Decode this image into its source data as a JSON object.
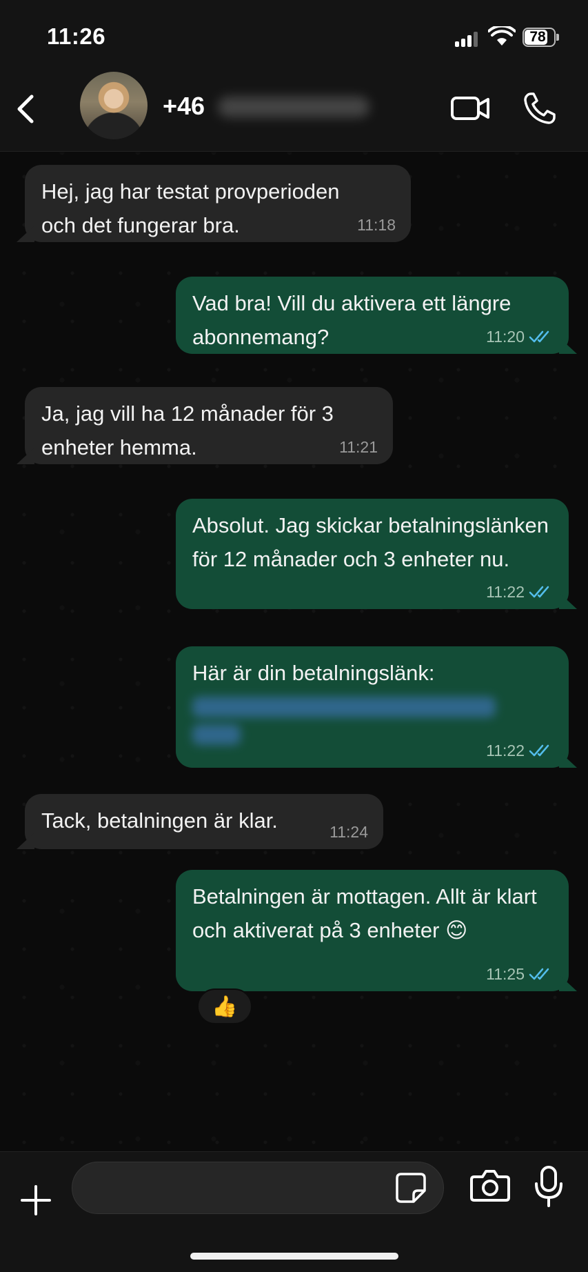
{
  "status_bar": {
    "time": "11:26",
    "battery": "78",
    "battery_level": 0.78
  },
  "header": {
    "contact_visible": "+46",
    "contact_blurred": "70 599 15 30",
    "back_icon": "chevron-left-icon",
    "video_icon": "video-camera-icon",
    "call_icon": "phone-icon"
  },
  "messages": [
    {
      "dir": "in",
      "text": "Hej, jag har testat provperioden och det fungerar bra.",
      "time": "11:18"
    },
    {
      "dir": "out",
      "text": "Vad bra! Vill du aktivera ett längre abonnemang?",
      "time": "11:20",
      "read": true
    },
    {
      "dir": "in",
      "text": "Ja, jag vill ha 12 månader för 3 enheter hemma.",
      "time": "11:21"
    },
    {
      "dir": "out",
      "text": "Absolut. Jag skickar betalningslänken för 12 månader och 3 enheter nu.",
      "time": "11:22",
      "read": true
    },
    {
      "dir": "out",
      "text": "Här är din betalningslänk:",
      "time": "11:22",
      "read": true,
      "link_blurred": true
    },
    {
      "dir": "in",
      "text": "Tack, betalningen är klar.",
      "time": "11:24"
    },
    {
      "dir": "out",
      "text": "Betalningen är mottagen. Allt är klart och aktiverat på 3 enheter 😊",
      "time": "11:25",
      "read": true
    }
  ],
  "reaction": "👍",
  "composer": {
    "placeholder": "",
    "value": ""
  },
  "colors": {
    "incoming": "#262626",
    "outgoing": "#134d37",
    "read_tick": "#53bdeb",
    "background": "#0b0b0b"
  }
}
